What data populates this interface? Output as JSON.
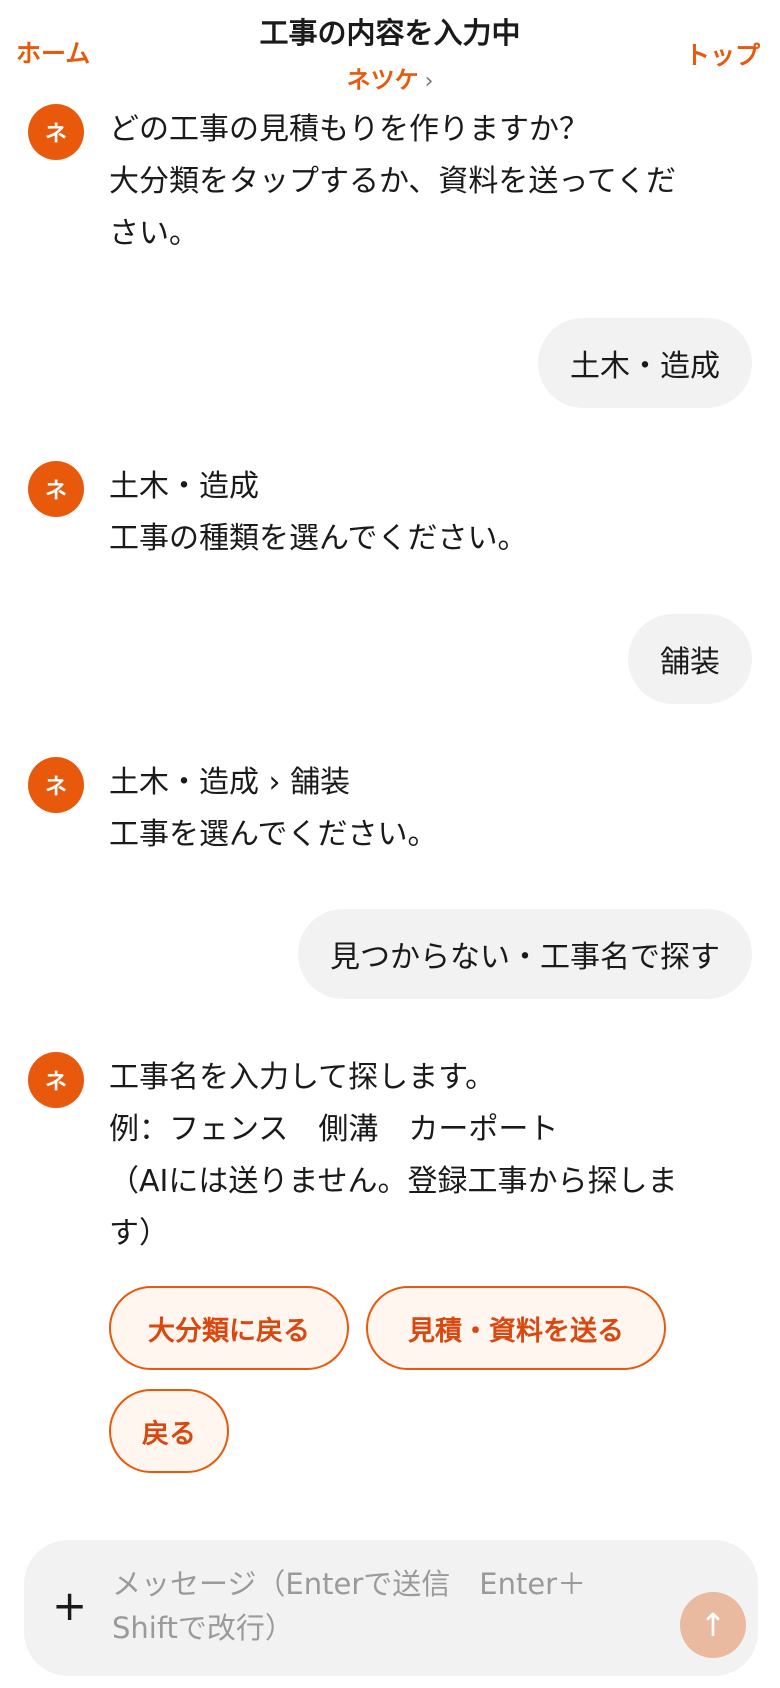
{
  "header": {
    "home_label": "ホーム",
    "title": "工事の内容を入力中",
    "subtitle": "ネツケ",
    "subtitle_chevron": "›",
    "top_label": "トップ"
  },
  "avatar_label": "ネ",
  "messages": {
    "bot1": {
      "line1": "どの工事の見積もりを作りますか？",
      "line2": "大分類をタップするか、資料を送ってくだ",
      "line3": "さい。"
    },
    "user1": "土木・造成",
    "bot2": {
      "line1": "土木・造成",
      "line2": "工事の種類を選んでください。"
    },
    "user2": "舗装",
    "bot3": {
      "line1": "土木・造成 › 舗装",
      "line2": "工事を選んでください。"
    },
    "user3": "見つからない・工事名で探す",
    "bot4": {
      "line1": "工事名を入力して探します。",
      "line2": "例：フェンス　側溝　カーポート",
      "line3": "（AIには送りません。登録工事から探しま",
      "line4": "す）"
    }
  },
  "quick_replies": {
    "back_to_category": "大分類に戻る",
    "send_materials": "見積・資料を送る",
    "back": "戻る"
  },
  "composer": {
    "plus_icon": "+",
    "placeholder_line1": "メッセージ（Enterで送信　Enter＋",
    "placeholder_line2": "Shiftで改行）",
    "send_icon": "↑"
  },
  "colors": {
    "accent": "#e8590c",
    "chip_text": "#d9480f",
    "bubble_bg": "#f2f2f2",
    "send_disabled": "#e9b9a0"
  }
}
